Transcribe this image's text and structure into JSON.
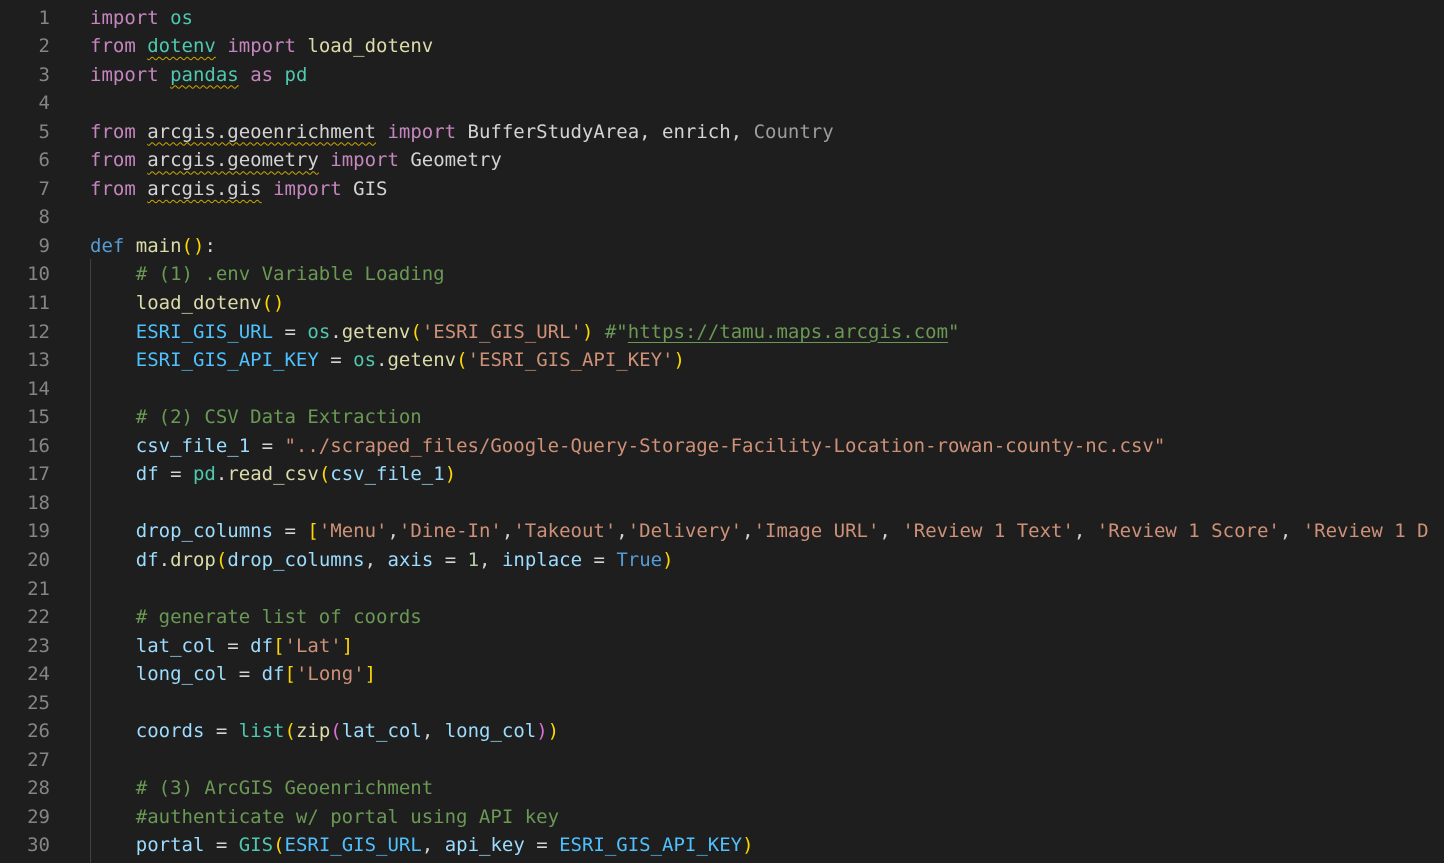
{
  "editor": {
    "lines": [
      {
        "n": "1",
        "tokens": [
          {
            "t": "import",
            "c": "kw"
          },
          {
            "t": " "
          },
          {
            "t": "os",
            "c": "mod"
          }
        ]
      },
      {
        "n": "2",
        "tokens": [
          {
            "t": "from",
            "c": "kw"
          },
          {
            "t": " "
          },
          {
            "t": "dotenv",
            "c": "mod",
            "u": "sq"
          },
          {
            "t": " "
          },
          {
            "t": "import",
            "c": "kw"
          },
          {
            "t": " "
          },
          {
            "t": "load_dotenv",
            "c": "fn"
          }
        ]
      },
      {
        "n": "3",
        "tokens": [
          {
            "t": "import",
            "c": "kw"
          },
          {
            "t": " "
          },
          {
            "t": "pandas",
            "c": "mod",
            "u": "sq"
          },
          {
            "t": " "
          },
          {
            "t": "as",
            "c": "kw"
          },
          {
            "t": " "
          },
          {
            "t": "pd",
            "c": "mod"
          }
        ]
      },
      {
        "n": "4",
        "tokens": []
      },
      {
        "n": "5",
        "tokens": [
          {
            "t": "from",
            "c": "kw"
          },
          {
            "t": " "
          },
          {
            "t": "arcgis.geoenrichment",
            "c": "ptx",
            "u": "sq"
          },
          {
            "t": " "
          },
          {
            "t": "import",
            "c": "kw"
          },
          {
            "t": " "
          },
          {
            "t": "BufferStudyArea",
            "c": "ptx"
          },
          {
            "t": ", ",
            "c": "ptx"
          },
          {
            "t": "enrich",
            "c": "ptx"
          },
          {
            "t": ", ",
            "c": "ptx"
          },
          {
            "t": "Country",
            "c": "dim"
          }
        ]
      },
      {
        "n": "6",
        "tokens": [
          {
            "t": "from",
            "c": "kw"
          },
          {
            "t": " "
          },
          {
            "t": "arcgis.geometry",
            "c": "ptx",
            "u": "sq"
          },
          {
            "t": " "
          },
          {
            "t": "import",
            "c": "kw"
          },
          {
            "t": " "
          },
          {
            "t": "Geometry",
            "c": "ptx"
          }
        ]
      },
      {
        "n": "7",
        "tokens": [
          {
            "t": "from",
            "c": "kw"
          },
          {
            "t": " "
          },
          {
            "t": "arcgis.gis",
            "c": "ptx",
            "u": "sq"
          },
          {
            "t": " "
          },
          {
            "t": "import",
            "c": "kw"
          },
          {
            "t": " "
          },
          {
            "t": "GIS",
            "c": "ptx"
          }
        ]
      },
      {
        "n": "8",
        "tokens": []
      },
      {
        "n": "9",
        "tokens": [
          {
            "t": "def",
            "c": "kwb"
          },
          {
            "t": " "
          },
          {
            "t": "main",
            "c": "fn"
          },
          {
            "t": "()",
            "c": "b1"
          },
          {
            "t": ":",
            "c": "ptx"
          }
        ]
      },
      {
        "n": "10",
        "tokens": [
          {
            "t": "    "
          },
          {
            "t": "# (1) .env Variable Loading",
            "c": "com"
          }
        ]
      },
      {
        "n": "11",
        "tokens": [
          {
            "t": "    "
          },
          {
            "t": "load_dotenv",
            "c": "fn"
          },
          {
            "t": "()",
            "c": "b1"
          }
        ]
      },
      {
        "n": "12",
        "tokens": [
          {
            "t": "    "
          },
          {
            "t": "ESRI_GIS_URL",
            "c": "cst"
          },
          {
            "t": " = ",
            "c": "ptx"
          },
          {
            "t": "os",
            "c": "mod"
          },
          {
            "t": ".",
            "c": "ptx"
          },
          {
            "t": "getenv",
            "c": "fn"
          },
          {
            "t": "(",
            "c": "b1"
          },
          {
            "t": "'ESRI_GIS_URL'",
            "c": "str"
          },
          {
            "t": ")",
            "c": "b1"
          },
          {
            "t": " #\"",
            "c": "com"
          },
          {
            "t": "https://tamu.maps.arcgis.com",
            "c": "com",
            "u": "url"
          },
          {
            "t": "\"",
            "c": "com"
          }
        ]
      },
      {
        "n": "13",
        "tokens": [
          {
            "t": "    "
          },
          {
            "t": "ESRI_GIS_API_KEY",
            "c": "cst"
          },
          {
            "t": " = ",
            "c": "ptx"
          },
          {
            "t": "os",
            "c": "mod"
          },
          {
            "t": ".",
            "c": "ptx"
          },
          {
            "t": "getenv",
            "c": "fn"
          },
          {
            "t": "(",
            "c": "b1"
          },
          {
            "t": "'ESRI_GIS_API_KEY'",
            "c": "str"
          },
          {
            "t": ")",
            "c": "b1"
          }
        ]
      },
      {
        "n": "14",
        "tokens": []
      },
      {
        "n": "15",
        "tokens": [
          {
            "t": "    "
          },
          {
            "t": "# (2) CSV Data Extraction",
            "c": "com"
          }
        ]
      },
      {
        "n": "16",
        "tokens": [
          {
            "t": "    "
          },
          {
            "t": "csv_file_1",
            "c": "var"
          },
          {
            "t": " = ",
            "c": "ptx"
          },
          {
            "t": "\"../scraped_files/Google-Query-Storage-Facility-Location-rowan-county-nc.csv\"",
            "c": "str"
          }
        ]
      },
      {
        "n": "17",
        "tokens": [
          {
            "t": "    "
          },
          {
            "t": "df",
            "c": "var"
          },
          {
            "t": " = ",
            "c": "ptx"
          },
          {
            "t": "pd",
            "c": "mod"
          },
          {
            "t": ".",
            "c": "ptx"
          },
          {
            "t": "read_csv",
            "c": "fn"
          },
          {
            "t": "(",
            "c": "b1"
          },
          {
            "t": "csv_file_1",
            "c": "var"
          },
          {
            "t": ")",
            "c": "b1"
          }
        ]
      },
      {
        "n": "18",
        "tokens": []
      },
      {
        "n": "19",
        "tokens": [
          {
            "t": "    "
          },
          {
            "t": "drop_columns",
            "c": "var"
          },
          {
            "t": " = ",
            "c": "ptx"
          },
          {
            "t": "[",
            "c": "b1"
          },
          {
            "t": "'Menu'",
            "c": "str"
          },
          {
            "t": ",",
            "c": "ptx"
          },
          {
            "t": "'Dine-In'",
            "c": "str"
          },
          {
            "t": ",",
            "c": "ptx"
          },
          {
            "t": "'Takeout'",
            "c": "str"
          },
          {
            "t": ",",
            "c": "ptx"
          },
          {
            "t": "'Delivery'",
            "c": "str"
          },
          {
            "t": ",",
            "c": "ptx"
          },
          {
            "t": "'Image URL'",
            "c": "str"
          },
          {
            "t": ", ",
            "c": "ptx"
          },
          {
            "t": "'Review 1 Text'",
            "c": "str"
          },
          {
            "t": ", ",
            "c": "ptx"
          },
          {
            "t": "'Review 1 Score'",
            "c": "str"
          },
          {
            "t": ", ",
            "c": "ptx"
          },
          {
            "t": "'Review 1 D",
            "c": "str"
          }
        ]
      },
      {
        "n": "20",
        "tokens": [
          {
            "t": "    "
          },
          {
            "t": "df",
            "c": "var"
          },
          {
            "t": ".",
            "c": "ptx"
          },
          {
            "t": "drop",
            "c": "fn"
          },
          {
            "t": "(",
            "c": "b1"
          },
          {
            "t": "drop_columns",
            "c": "var"
          },
          {
            "t": ", ",
            "c": "ptx"
          },
          {
            "t": "axis",
            "c": "var"
          },
          {
            "t": " = ",
            "c": "ptx"
          },
          {
            "t": "1",
            "c": "num"
          },
          {
            "t": ", ",
            "c": "ptx"
          },
          {
            "t": "inplace",
            "c": "var"
          },
          {
            "t": " = ",
            "c": "ptx"
          },
          {
            "t": "True",
            "c": "kwb"
          },
          {
            "t": ")",
            "c": "b1"
          }
        ]
      },
      {
        "n": "21",
        "tokens": []
      },
      {
        "n": "22",
        "tokens": [
          {
            "t": "    "
          },
          {
            "t": "# generate list of coords",
            "c": "com"
          }
        ]
      },
      {
        "n": "23",
        "tokens": [
          {
            "t": "    "
          },
          {
            "t": "lat_col",
            "c": "var"
          },
          {
            "t": " = ",
            "c": "ptx"
          },
          {
            "t": "df",
            "c": "var"
          },
          {
            "t": "[",
            "c": "b1"
          },
          {
            "t": "'Lat'",
            "c": "str"
          },
          {
            "t": "]",
            "c": "b1"
          }
        ]
      },
      {
        "n": "24",
        "tokens": [
          {
            "t": "    "
          },
          {
            "t": "long_col",
            "c": "var"
          },
          {
            "t": " = ",
            "c": "ptx"
          },
          {
            "t": "df",
            "c": "var"
          },
          {
            "t": "[",
            "c": "b1"
          },
          {
            "t": "'Long'",
            "c": "str"
          },
          {
            "t": "]",
            "c": "b1"
          }
        ]
      },
      {
        "n": "25",
        "tokens": []
      },
      {
        "n": "26",
        "tokens": [
          {
            "t": "    "
          },
          {
            "t": "coords",
            "c": "var"
          },
          {
            "t": " = ",
            "c": "ptx"
          },
          {
            "t": "list",
            "c": "mod"
          },
          {
            "t": "(",
            "c": "b1"
          },
          {
            "t": "zip",
            "c": "fn"
          },
          {
            "t": "(",
            "c": "b2"
          },
          {
            "t": "lat_col",
            "c": "var"
          },
          {
            "t": ", ",
            "c": "ptx"
          },
          {
            "t": "long_col",
            "c": "var"
          },
          {
            "t": ")",
            "c": "b2"
          },
          {
            "t": ")",
            "c": "b1"
          }
        ]
      },
      {
        "n": "27",
        "tokens": []
      },
      {
        "n": "28",
        "tokens": [
          {
            "t": "    "
          },
          {
            "t": "# (3) ArcGIS Geoenrichment",
            "c": "com"
          }
        ]
      },
      {
        "n": "29",
        "tokens": [
          {
            "t": "    "
          },
          {
            "t": "#authenticate w/ portal using API key",
            "c": "com"
          }
        ]
      },
      {
        "n": "30",
        "tokens": [
          {
            "t": "    "
          },
          {
            "t": "portal",
            "c": "var"
          },
          {
            "t": " = ",
            "c": "ptx"
          },
          {
            "t": "GIS",
            "c": "mod"
          },
          {
            "t": "(",
            "c": "b1"
          },
          {
            "t": "ESRI_GIS_URL",
            "c": "cst"
          },
          {
            "t": ", ",
            "c": "ptx"
          },
          {
            "t": "api_key",
            "c": "var"
          },
          {
            "t": " = ",
            "c": "ptx"
          },
          {
            "t": "ESRI_GIS_API_KEY",
            "c": "cst"
          },
          {
            "t": ")",
            "c": "b1"
          }
        ]
      }
    ]
  }
}
